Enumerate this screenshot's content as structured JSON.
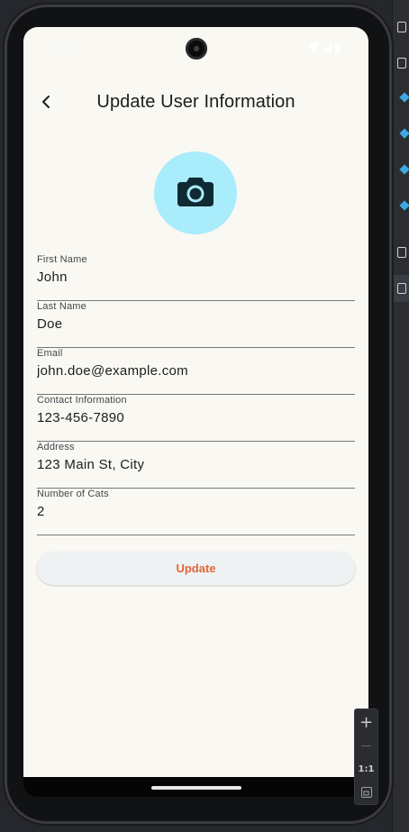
{
  "status_bar": {
    "time": "12:27"
  },
  "app_bar": {
    "title": "Update User Information",
    "back_icon": "chevron-left-icon"
  },
  "avatar": {
    "icon": "camera-icon",
    "background_color": "#a9ecfb"
  },
  "form": {
    "fields": [
      {
        "label": "First Name",
        "value": "John"
      },
      {
        "label": "Last Name",
        "value": "Doe"
      },
      {
        "label": "Email",
        "value": "john.doe@example.com"
      },
      {
        "label": "Contact Information",
        "value": "123-456-7890"
      },
      {
        "label": "Address",
        "value": "123 Main St, City"
      },
      {
        "label": "Number of Cats",
        "value": "2"
      }
    ]
  },
  "update_button": {
    "label": "Update",
    "text_color": "#e2673a"
  },
  "emulator_zoom": {
    "zoom_in": "+",
    "zoom_out": "—",
    "actual_size": "1:1"
  },
  "colors": {
    "screen_background": "#f9f8f2",
    "accent": "#e2673a"
  }
}
